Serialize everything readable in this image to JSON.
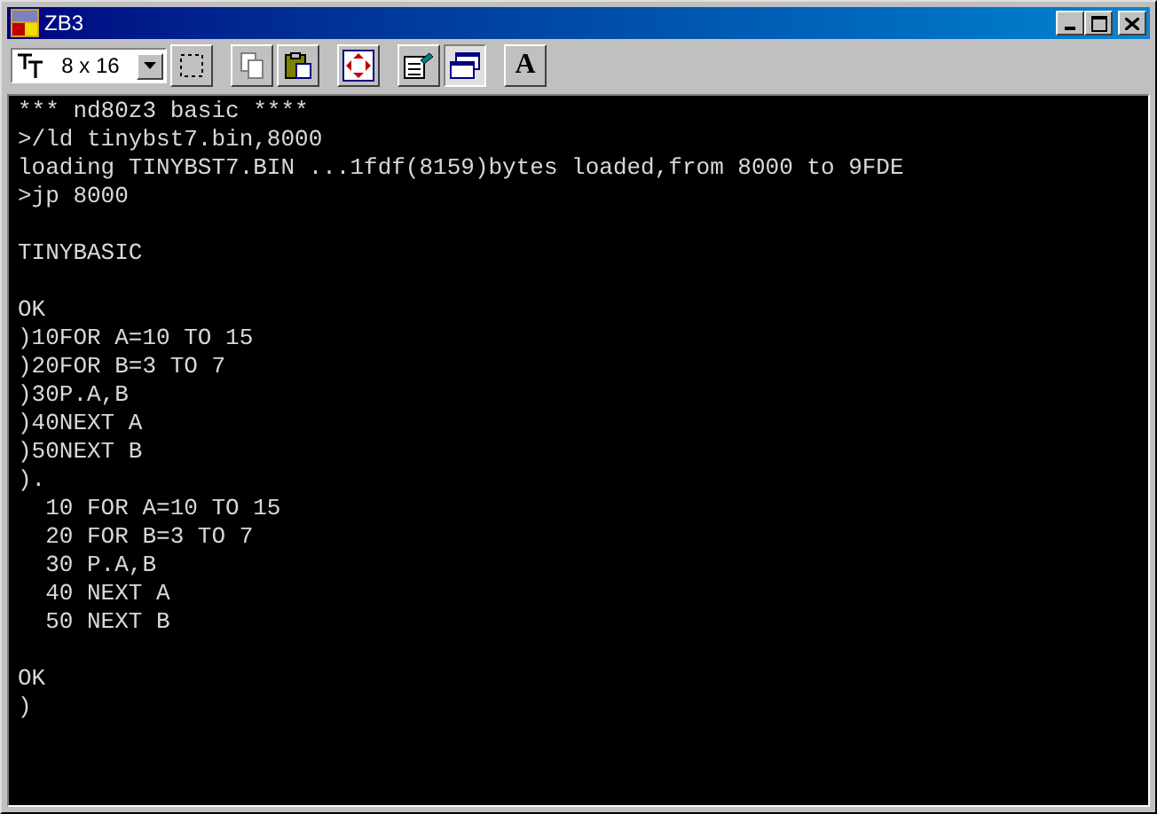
{
  "window": {
    "title": "ZB3"
  },
  "toolbar": {
    "font_size": {
      "value": "8 x 16"
    },
    "buttons": [
      {
        "kind": "select",
        "pressed": false,
        "disabled": false
      },
      {
        "kind": "copy",
        "pressed": false,
        "disabled": true
      },
      {
        "kind": "paste",
        "pressed": false,
        "disabled": false
      },
      {
        "kind": "move",
        "pressed": false,
        "disabled": false
      },
      {
        "kind": "properties",
        "pressed": false,
        "disabled": false
      },
      {
        "kind": "window",
        "pressed": true,
        "disabled": false
      },
      {
        "kind": "font",
        "label": "A",
        "pressed": false,
        "disabled": false
      }
    ]
  },
  "console": {
    "blocks": [
      [
        "*** nd80z3 basic ****",
        ">/ld tinybst7.bin,8000",
        "loading TINYBST7.BIN ...1fdf(8159)bytes loaded,from 8000 to 9FDE",
        ">jp 8000"
      ],
      [
        "TINYBASIC"
      ],
      [
        "OK",
        ")10FOR A=10 TO 15",
        ")20FOR B=3 TO 7",
        ")30P.A,B",
        ")40NEXT A",
        ")50NEXT B",
        ").",
        "  10 FOR A=10 TO 15",
        "  20 FOR B=3 TO 7",
        "  30 P.A,B",
        "  40 NEXT A",
        "  50 NEXT B"
      ],
      [
        "OK",
        ")"
      ]
    ]
  }
}
